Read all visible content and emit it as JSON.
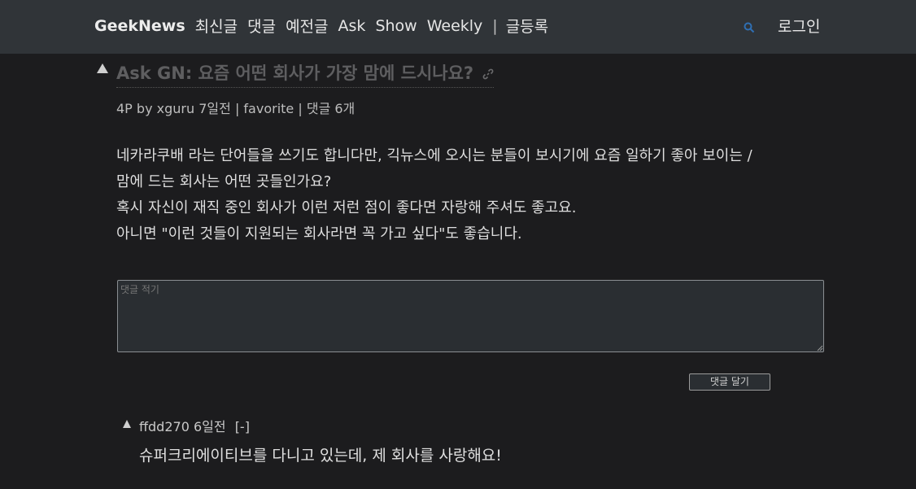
{
  "header": {
    "brand": "GeekNews",
    "nav": [
      "최신글",
      "댓글",
      "예전글",
      "Ask",
      "Show",
      "Weekly"
    ],
    "separator": "|",
    "submit": "글등록",
    "login": "로그인"
  },
  "topic": {
    "title": "Ask GN: 요즘 어떤 회사가 가장 맘에 드시나요?",
    "points": "4P",
    "by": "by",
    "author": "xguru",
    "time": "7일전",
    "sep": "|",
    "favorite": "favorite",
    "comments": "댓글 6개",
    "body": [
      "네카라쿠배 라는 단어들을 쓰기도 합니다만, 긱뉴스에 오시는 분들이 보시기에 요즘 일하기 좋아 보이는 /",
      "맘에 드는 회사는 어떤 곳들인가요?",
      "혹시 자신이 재직 중인 회사가 이런 저런 점이 좋다면 자랑해 주셔도 좋고요.",
      "아니면 \"이런 것들이 지원되는 회사라면 꼭 가고 싶다\"도 좋습니다."
    ]
  },
  "comment_form": {
    "placeholder": "댓글 적기",
    "submit_label": "댓글 달기"
  },
  "comments": [
    {
      "author": "ffdd270",
      "time": "6일전",
      "collapse": "[-]",
      "text": "슈퍼크리에이티브를 다니고 있는데, 제 회사를 사랑해요!"
    }
  ],
  "colors": {
    "background": "#1c1c1e",
    "topbar": "#303438",
    "title_visited": "#5e5e60"
  }
}
